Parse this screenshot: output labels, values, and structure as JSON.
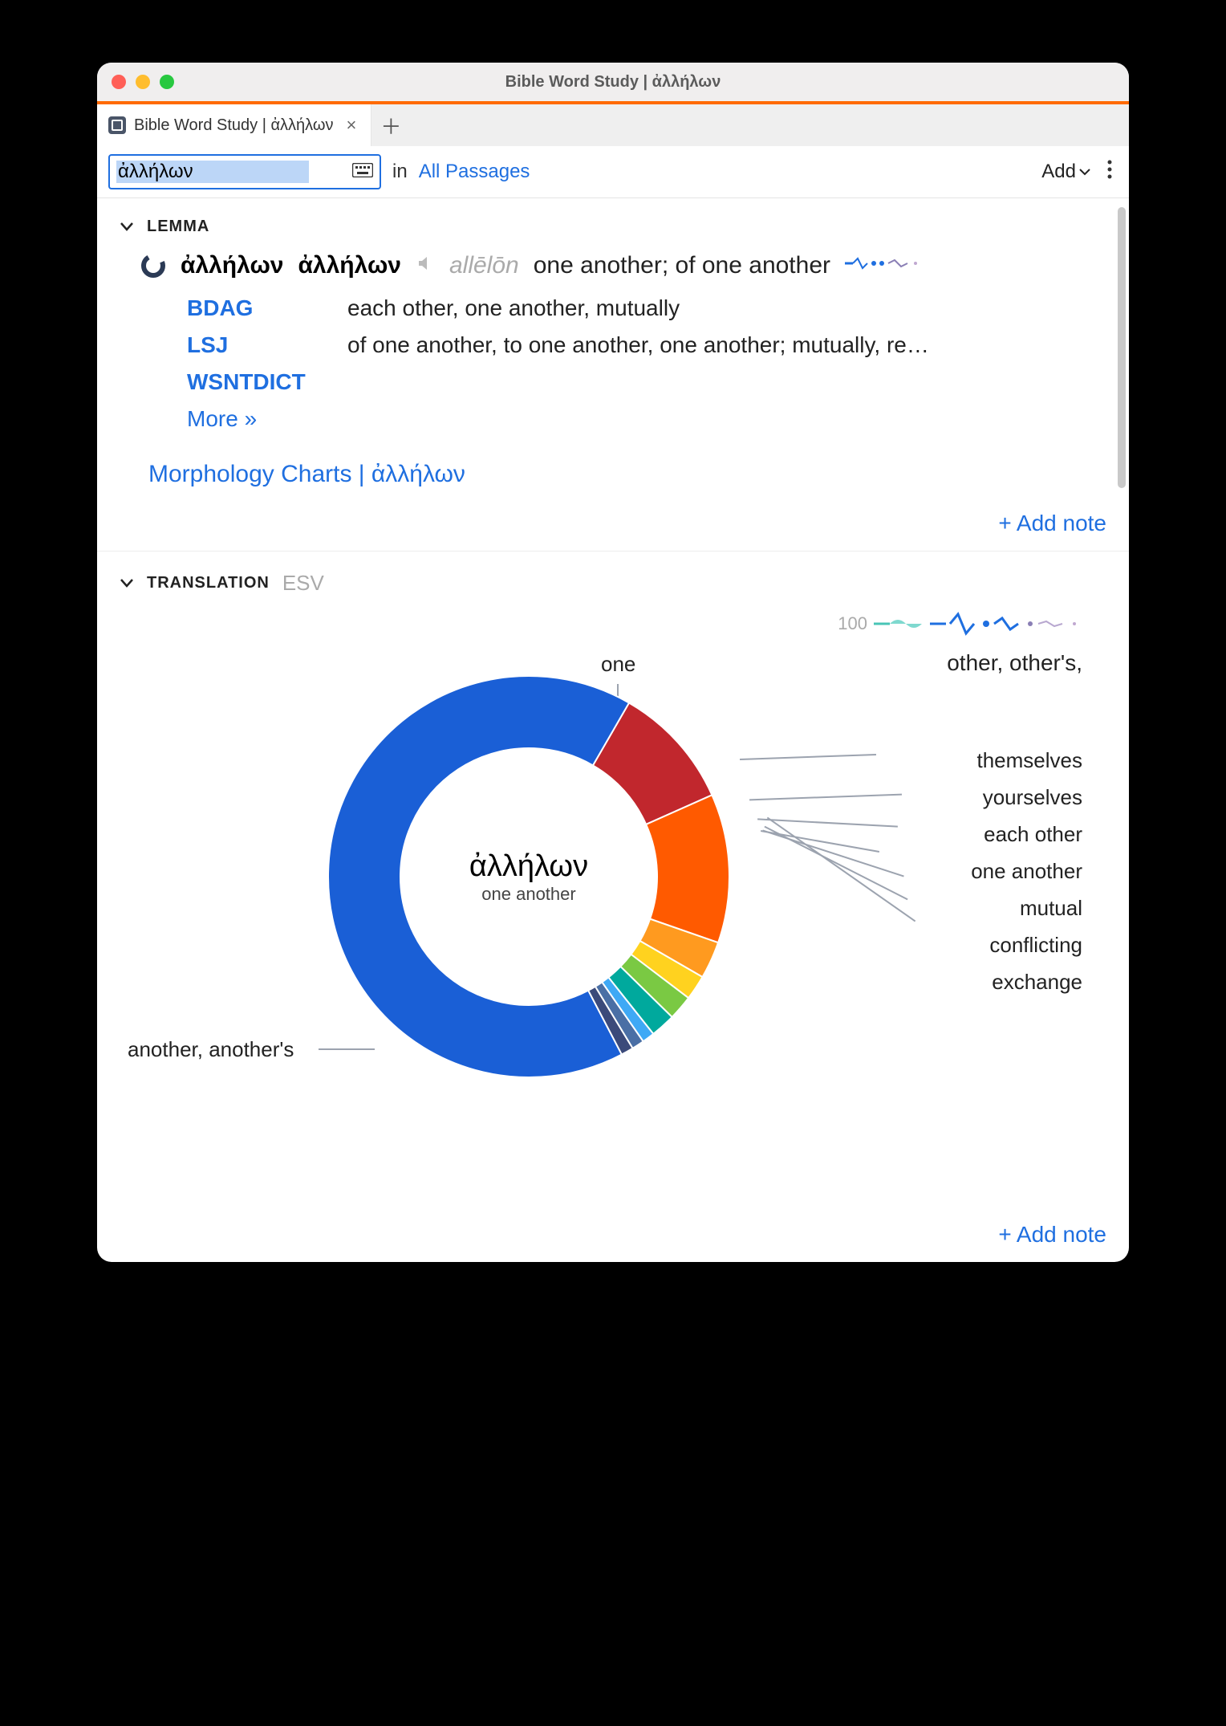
{
  "window": {
    "title": "Bible Word Study | ἀλλήλων"
  },
  "tab": {
    "label": "Bible Word Study | ἀλλήλων"
  },
  "toolbar": {
    "search_value": "ἀλλήλων",
    "in_label": "in",
    "scope": "All Passages",
    "add_label": "Add"
  },
  "lemma": {
    "section_title": "LEMMA",
    "headword": "ἀλλήλων",
    "headword2": "ἀλλήλων",
    "transliteration": "allēlōn",
    "gloss": "one another; of one another",
    "dicts": [
      {
        "abbr": "BDAG",
        "def": "each other, one another, mutually"
      },
      {
        "abbr": "LSJ",
        "def": "of one another, to one another, one another; mutually, re…"
      },
      {
        "abbr": "WSNTDICT",
        "def": ""
      }
    ],
    "more": "More »",
    "morph": "Morphology Charts  |  ἀλλήλων",
    "add_note": "+ Add note"
  },
  "translation": {
    "section_title": "TRANSLATION",
    "version": "ESV",
    "spark_count": "100",
    "spark_label": "other, other's,",
    "center_greek": "ἀλλήλων",
    "center_sub": "one another",
    "add_note": "+ Add note",
    "labels": {
      "one": "one",
      "another": "another, another's",
      "themselves": "themselves",
      "yourselves": "yourselves",
      "each_other": "each other",
      "one_another": "one another",
      "mutual": "mutual",
      "conflicting": "conflicting",
      "exchange": "exchange"
    }
  },
  "chart_data": {
    "type": "pie",
    "title": "ἀλλήλων — ESV translations",
    "total": 100,
    "series": [
      {
        "name": "another, another's",
        "value": 66,
        "color": "#1a5fd6"
      },
      {
        "name": "one",
        "value": 10,
        "color": "#c1272d"
      },
      {
        "name": "other, other's",
        "value": 12,
        "color": "#ff5a00"
      },
      {
        "name": "themselves",
        "value": 3,
        "color": "#ff9a1f"
      },
      {
        "name": "yourselves",
        "value": 2,
        "color": "#ffd21f"
      },
      {
        "name": "each other",
        "value": 2,
        "color": "#7ac943"
      },
      {
        "name": "one another",
        "value": 2,
        "color": "#00a99d"
      },
      {
        "name": "mutual",
        "value": 1,
        "color": "#3fa9f5"
      },
      {
        "name": "conflicting",
        "value": 1,
        "color": "#4a6fa5"
      },
      {
        "name": "exchange",
        "value": 1,
        "color": "#3b4a7a"
      }
    ]
  }
}
